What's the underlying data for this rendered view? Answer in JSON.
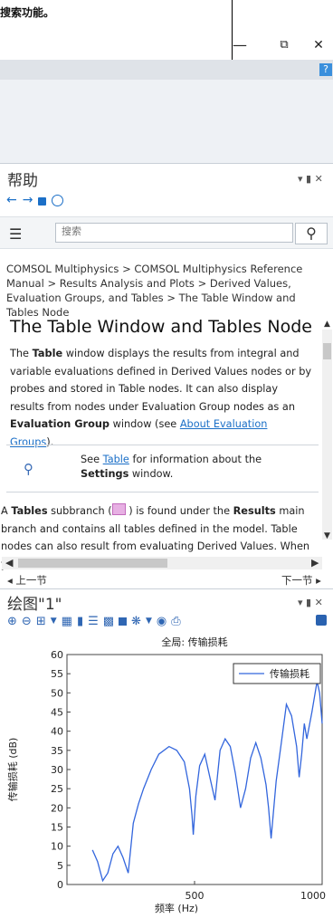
{
  "window": {
    "top_text": "搜索功能。",
    "buttons": {
      "minimize": "—",
      "restore": "⧉",
      "close": "✕"
    },
    "help_badge": "?"
  },
  "help": {
    "title": "帮助",
    "controls": "▾ ▮ ✕",
    "nav": {
      "back": "←",
      "forward": "→",
      "lock": "🔒",
      "globe": "🌐"
    },
    "search": {
      "placeholder": "搜索",
      "value": ""
    },
    "breadcrumb": "COMSOL Multiphysics > COMSOL Multiphysics Reference Manual > Results Analysis and Plots > Derived Values, Evaluation Groups, and Tables > The Table Window and Tables Node",
    "heading": "The Table Window and Tables Node",
    "para1_a": "The ",
    "para1_b": "Table",
    "para1_c": " window displays the results from integral and variable evaluations defined in Derived Values nodes or by probes and stored in Table nodes. It can also display results from nodes under Evaluation Group nodes as an ",
    "para1_d": "Evaluation Group",
    "para1_e": " window (see ",
    "para1_link": "About Evaluation Groups",
    "para1_f": ").",
    "note_a": "See ",
    "note_link": "Table",
    "note_b": " for information about the ",
    "note_c": "Settings",
    "note_d": " window.",
    "para2_a": "A ",
    "para2_b": "Tables",
    "para2_c": " subbranch (",
    "para2_d": ") is found under the ",
    "para2_e": "Results",
    "para2_f": " main branch and contains all tables defined in the model. Table nodes can also result from evaluating Derived Values. When you select a",
    "prev": "◂ 上一节",
    "next": "下一节 ▸"
  },
  "plot": {
    "title": "绘图\"1\"",
    "controls": "▾ ▮ ✕"
  },
  "chart_data": {
    "type": "line",
    "title": "全局: 传输损耗",
    "xlabel": "频率 (Hz)",
    "ylabel": "传输损耗 (dB)",
    "xlim": [
      0,
      1000
    ],
    "ylim": [
      0,
      60
    ],
    "xticks": [
      500,
      1000
    ],
    "yticks": [
      0,
      5,
      10,
      15,
      20,
      25,
      30,
      35,
      40,
      45,
      50,
      55,
      60
    ],
    "legend_position": "top-right",
    "grid": false,
    "series": [
      {
        "name": "传输损耗",
        "color": "#3366dd",
        "x": [
          100,
          120,
          140,
          160,
          180,
          200,
          220,
          240,
          260,
          280,
          300,
          330,
          360,
          400,
          430,
          460,
          480,
          490,
          495,
          500,
          505,
          520,
          540,
          560,
          580,
          600,
          620,
          640,
          660,
          680,
          700,
          720,
          740,
          760,
          780,
          790,
          800,
          820,
          840,
          860,
          880,
          900,
          910,
          920,
          930,
          940,
          960,
          980,
          990,
          995,
          1000
        ],
        "y": [
          9,
          6,
          1,
          3,
          8,
          10,
          7,
          3,
          16,
          21,
          25,
          30,
          34,
          36,
          35,
          32,
          25,
          18,
          13,
          18,
          23,
          31,
          34,
          28,
          22,
          35,
          38,
          36,
          29,
          20,
          25,
          33,
          37,
          33,
          26,
          20,
          12,
          27,
          37,
          47,
          44,
          36,
          28,
          34,
          42,
          38,
          45,
          53,
          50,
          46,
          42
        ]
      }
    ]
  }
}
